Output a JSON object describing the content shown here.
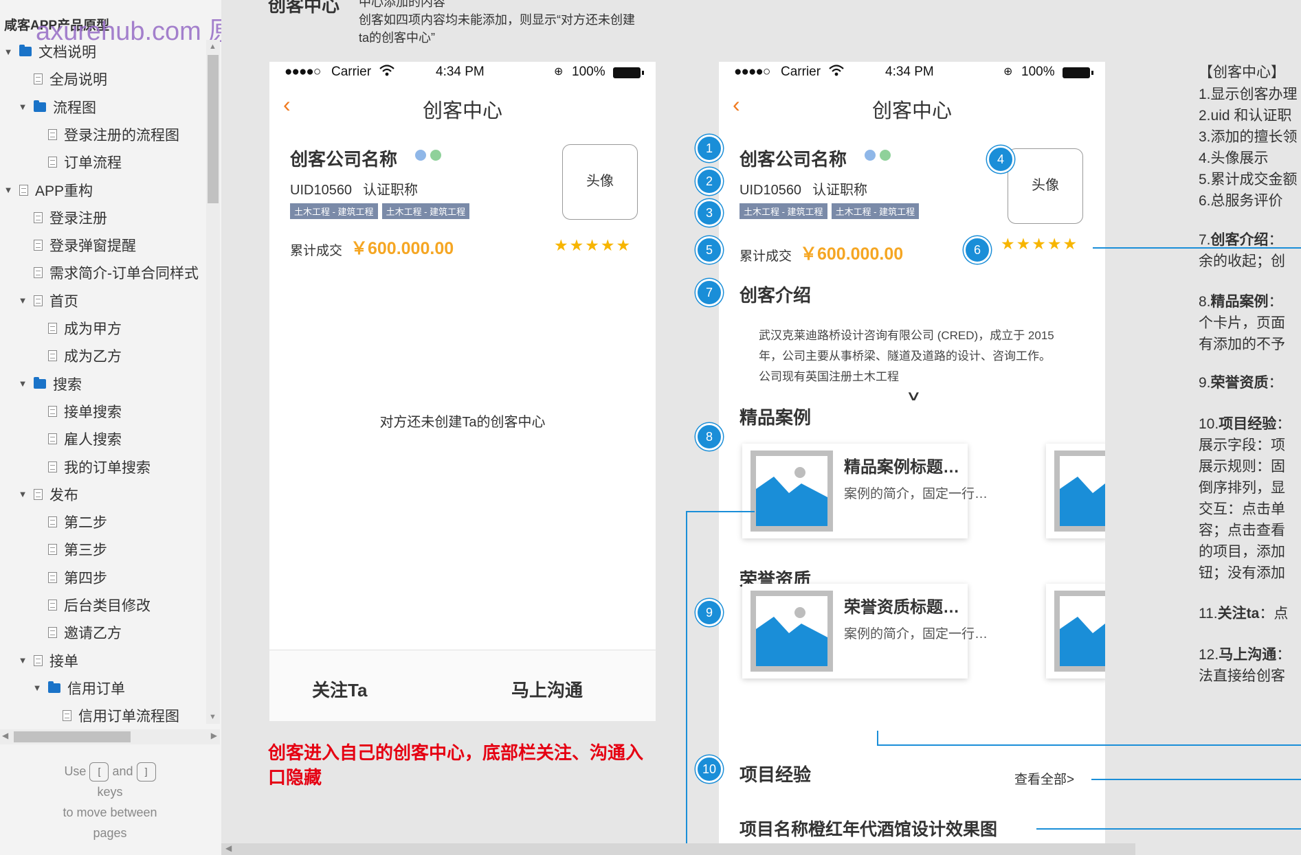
{
  "sidebar": {
    "project_title": "咸客APP产品原型",
    "watermark": "axurehub.com 原型资源站",
    "tree": [
      {
        "label": "文档说明",
        "type": "folder",
        "level": 0,
        "expanded": true
      },
      {
        "label": "全局说明",
        "type": "page",
        "level": 1
      },
      {
        "label": "流程图",
        "type": "folder",
        "level": 1,
        "expanded": true
      },
      {
        "label": "登录注册的流程图",
        "type": "page",
        "level": 2
      },
      {
        "label": "订单流程",
        "type": "page",
        "level": 2
      },
      {
        "label": "APP重构",
        "type": "page",
        "level": 0,
        "expanded": true
      },
      {
        "label": "登录注册",
        "type": "page",
        "level": 1
      },
      {
        "label": "登录弹窗提醒",
        "type": "page",
        "level": 1
      },
      {
        "label": "需求简介-订单合同样式",
        "type": "page",
        "level": 1
      },
      {
        "label": "首页",
        "type": "page",
        "level": 1,
        "expanded": true
      },
      {
        "label": "成为甲方",
        "type": "page",
        "level": 2
      },
      {
        "label": "成为乙方",
        "type": "page",
        "level": 2
      },
      {
        "label": "搜索",
        "type": "folder",
        "level": 1,
        "expanded": true
      },
      {
        "label": "接单搜索",
        "type": "page",
        "level": 2
      },
      {
        "label": "雇人搜索",
        "type": "page",
        "level": 2
      },
      {
        "label": "我的订单搜索",
        "type": "page",
        "level": 2
      },
      {
        "label": "发布",
        "type": "page",
        "level": 1,
        "expanded": true
      },
      {
        "label": "第二步",
        "type": "page",
        "level": 2
      },
      {
        "label": "第三步",
        "type": "page",
        "level": 2
      },
      {
        "label": "第四步",
        "type": "page",
        "level": 2
      },
      {
        "label": "后台类目修改",
        "type": "page",
        "level": 2
      },
      {
        "label": "邀请乙方",
        "type": "page",
        "level": 2
      },
      {
        "label": "接单",
        "type": "page",
        "level": 1,
        "expanded": true
      },
      {
        "label": "信用订单",
        "type": "folder",
        "level": 2,
        "expanded": true
      },
      {
        "label": "信用订单流程图",
        "type": "page",
        "level": 3
      }
    ],
    "help": {
      "use": "Use",
      "and": "and",
      "keys": "keys",
      "line3": "to move between",
      "line4": "pages",
      "key_left": "[",
      "key_right": "]"
    }
  },
  "canvas": {
    "top_title": "创客中心",
    "top_note": [
      "中心添加的内容",
      "创客如四项内容均未能添加，则显示“对方还未创建",
      "ta的创客中心”"
    ],
    "status": {
      "carrier": "Carrier",
      "time": "4:34 PM",
      "battery": "100%",
      "signal": "●●●●○"
    },
    "nav_title": "创客中心",
    "back_icon": "chevron-left-icon",
    "company_name": "创客公司名称",
    "uid": "UID10560",
    "cert": "认证职称",
    "tags": [
      "土木工程 - 建筑工程",
      "土木工程 - 建筑工程"
    ],
    "acc_label": "累计成交",
    "acc_value": "￥600.000.00",
    "stars": "★★★★★",
    "avatar": "头像",
    "empty_text": "对方还未创建Ta的创客中心",
    "follow": "关注Ta",
    "chat": "马上沟通",
    "red_note": "创客进入自己的创客中心，底部栏关注、沟通入口隐藏",
    "intro_title": "创客介绍",
    "intro_text": "武汉克莱迪路桥设计咨询有限公司 (CRED)，成立于 2015 年，公司主要从事桥梁、隧道及道路的设计、咨询工作。公司现有英国注册土木工程",
    "cases_title": "精品案例",
    "case_title": "精品案例标题…",
    "case_desc": "案例的简介，固定一行…",
    "honor_title": "荣誉资质",
    "honor_card_title": "荣誉资质标题…",
    "honor_desc": "案例的简介，固定一行…",
    "exp_title": "项目经验",
    "view_all": "查看全部>",
    "proj_name": "项目名称橙红年代酒馆设计效果图",
    "markers": [
      "1",
      "2",
      "3",
      "4",
      "5",
      "6",
      "7",
      "8",
      "9",
      "10"
    ],
    "badge_colors": [
      "#8fb7e8",
      "#8fd19a"
    ],
    "accent": "#1a8ed8"
  },
  "notes": {
    "header": "【创客中心】",
    "items": [
      "1.显示创客办理",
      "2.uid 和认证职",
      "3.添加的擅长领",
      "4.头像展示",
      "5.累计成交金额",
      "6.总服务评价"
    ],
    "n7a": "7.",
    "n7b": "创客介绍",
    "n7c": "：",
    "n7d": "余的收起；创",
    "n8a": "8.",
    "n8b": "精品案例",
    "n8c": "：",
    "n8d": "个卡片，页面",
    "n8e": "有添加的不予",
    "n9a": "9.",
    "n9b": "荣誉资质",
    "n9c": "：",
    "n10a": "10.",
    "n10b": "项目经验",
    "n10c": "：",
    "n10d": [
      "展示字段：项",
      "展示规则：固",
      "倒序排列，显",
      "交互：点击单",
      "容；点击查看",
      "的项目，添加",
      "钮；没有添加"
    ],
    "n11a": "11.",
    "n11b": "关注ta",
    "n11c": "：点",
    "n12a": "12.",
    "n12b": "马上沟通",
    "n12c": "：",
    "n12d": "法直接给创客"
  }
}
